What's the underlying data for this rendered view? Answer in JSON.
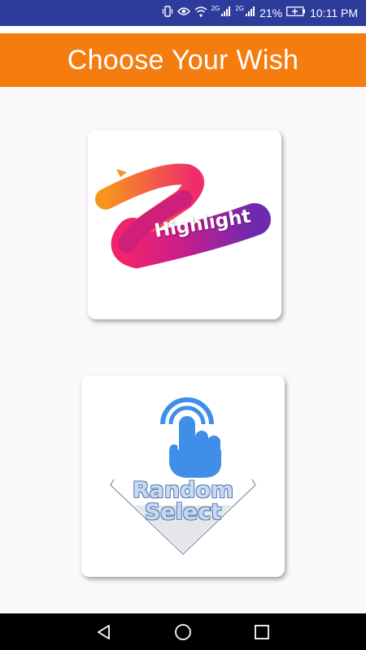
{
  "status_bar": {
    "icons": [
      "vibrate-icon",
      "eye-icon",
      "wifi-icon",
      "signal-icon",
      "signal-icon",
      "battery-icon"
    ],
    "network1": "2G",
    "network2": "2G",
    "battery": "21%",
    "time": "10:11 PM"
  },
  "app_bar": {
    "title": "Choose Your Wish",
    "color": "#f57c0f"
  },
  "cards": {
    "highlight": {
      "label": "Highlight"
    },
    "random": {
      "label_line1": "Random",
      "label_line2": "Select"
    }
  },
  "nav_bar": {
    "buttons": [
      "back-icon",
      "home-icon",
      "recents-icon"
    ]
  }
}
